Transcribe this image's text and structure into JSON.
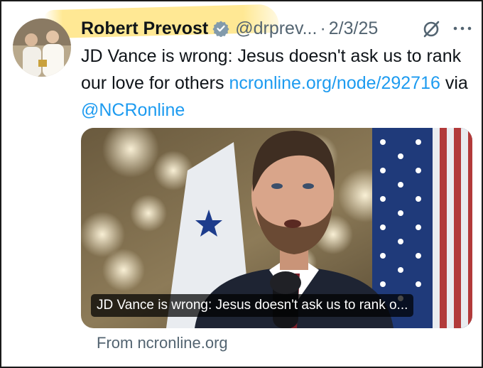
{
  "tweet": {
    "author_name": "Robert Prevost",
    "handle": "@drprev...",
    "separator": "·",
    "date": "2/3/25",
    "text": "JD Vance is wrong: Jesus doesn't ask us to rank our love for others ",
    "link": "ncronline.org/node/292716",
    "via_text": " via ",
    "mention": "@NCRonline",
    "verified_color": "#829aab",
    "accent_color": "#1d9bf0",
    "highlight_color": "#ffd63c"
  },
  "link_card": {
    "caption": "JD Vance is wrong: Jesus doesn't ask us to rank o...",
    "source": "From ncronline.org"
  },
  "icons": [
    "verified-badge-icon",
    "grok-icon",
    "more-options-icon"
  ]
}
